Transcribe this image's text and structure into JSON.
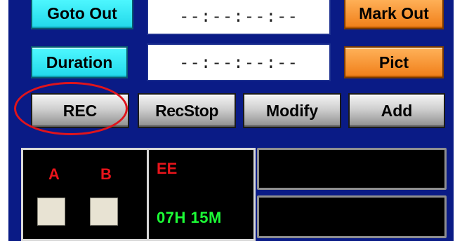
{
  "row_goto": {
    "goto_out_label": "Goto Out",
    "timecode": "--:--:--:--",
    "mark_out_label": "Mark Out"
  },
  "row_duration": {
    "duration_label": "Duration",
    "timecode": "--:--:--:--",
    "pict_label": "Pict"
  },
  "transport": {
    "rec_label": "REC",
    "recstop_label": "RecStop",
    "modify_label": "Modify",
    "add_label": "Add"
  },
  "status": {
    "channel_a": "A",
    "channel_b": "B",
    "mode": "EE",
    "remaining": "07H 15M"
  },
  "colors": {
    "frame_bg": "#0a1b86",
    "cyan_button": "#21d8ea",
    "orange_button": "#f07e18",
    "highlight_ring": "#e0141c",
    "status_red": "#e8141b",
    "status_green": "#1cff36"
  }
}
